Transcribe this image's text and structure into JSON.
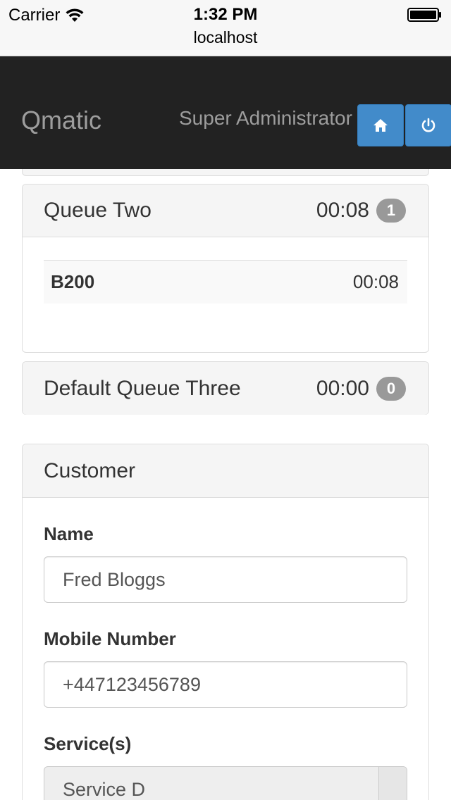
{
  "status_bar": {
    "carrier": "Carrier",
    "time": "1:32 PM",
    "url": "localhost"
  },
  "navbar": {
    "brand": "Qmatic",
    "user": "Super Administrator",
    "home_icon": "home-icon",
    "power_icon": "power-icon"
  },
  "queues": [
    {
      "name": "Queue Two",
      "wait": "00:08",
      "count": "1",
      "tickets": [
        {
          "id": "B200",
          "time": "00:08"
        }
      ]
    },
    {
      "name": "Default Queue Three",
      "wait": "00:00",
      "count": "0"
    }
  ],
  "customer": {
    "title": "Customer",
    "name_label": "Name",
    "name_value": "Fred Bloggs",
    "mobile_label": "Mobile Number",
    "mobile_value": "+447123456789",
    "services_label": "Service(s)",
    "services_value": "Service D"
  },
  "colors": {
    "navbar_bg": "#222222",
    "button_primary": "#428bca",
    "badge": "#999999"
  }
}
